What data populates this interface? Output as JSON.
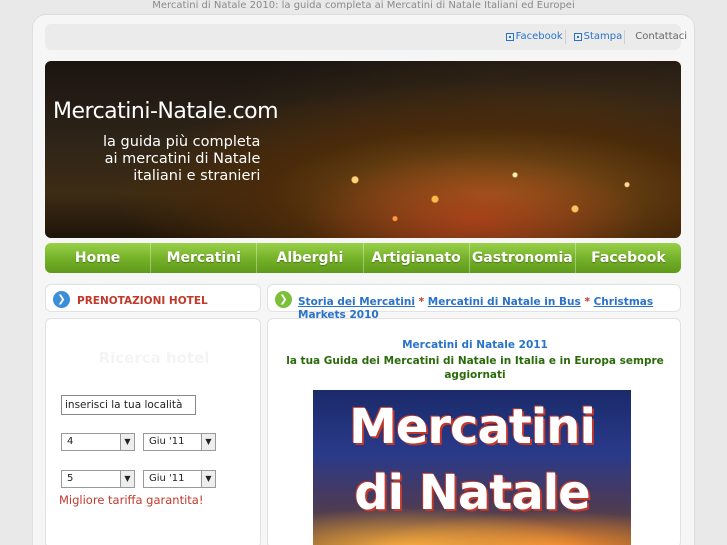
{
  "header": {
    "tagline": "Mercatini di Natale 2010: la guida completa ai Mercatini di Natale Italiani ed Europei"
  },
  "toplinks": {
    "facebook": "Facebook",
    "stampa": "Stampa",
    "contattaci": "Contattaci"
  },
  "banner": {
    "title": "Mercatini-Natale.com",
    "subtitle_line1": "la guida più completa",
    "subtitle_line2": "ai mercatini di Natale",
    "subtitle_line3": "italiani e stranieri"
  },
  "nav": {
    "items": [
      "Home",
      "Mercatini",
      "Alberghi",
      "Artigianato",
      "Gastronomia",
      "Facebook"
    ]
  },
  "sidebar": {
    "heading": "PRENOTAZIONI HOTEL",
    "search_title": "Ricerca hotel",
    "location_value": "inserisci la tua località",
    "checkin_day": "4",
    "checkin_month": "Giu '11",
    "checkout_day": "5",
    "checkout_month": "Giu '11",
    "tariff_note": "Migliore tariffa garantita!"
  },
  "breadcrumbs": {
    "link1": "Storia dei Mercatini",
    "sep": "*",
    "link2": "Mercatini di Natale in Bus",
    "link3": "Christmas Markets 2010"
  },
  "main": {
    "title": "Mercatini di Natale 2011",
    "subtitle": "la tua Guida dei Mercatini di Natale in Italia e in Europa sempre aggiornati",
    "feature_line1": "Mercatini",
    "feature_line2": "di Natale"
  },
  "colors": {
    "accent_green": "#76b22a",
    "link_blue": "#2a73c8",
    "brand_red": "#c0392b"
  }
}
